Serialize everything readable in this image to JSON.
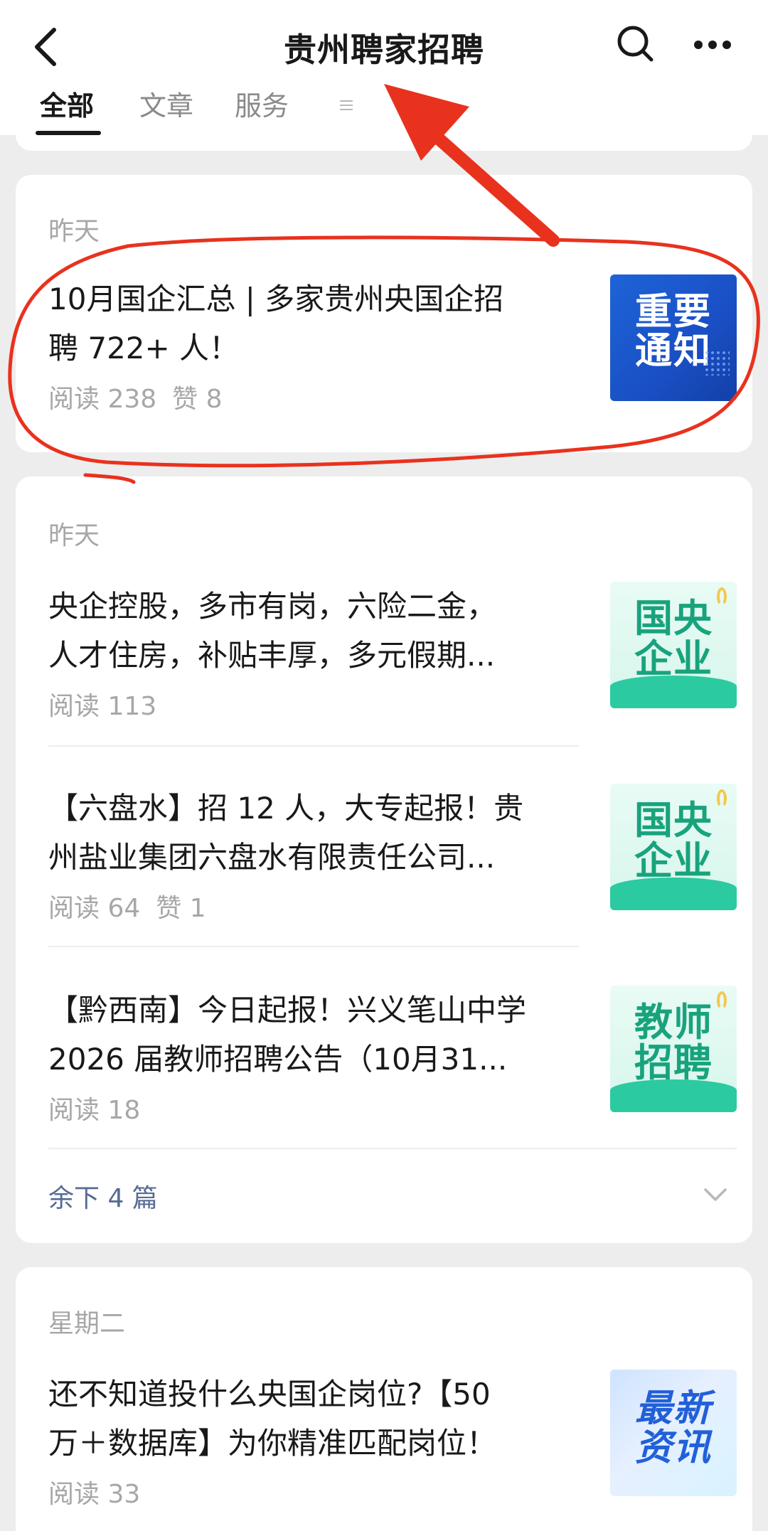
{
  "header": {
    "title": "贵州聘家招聘",
    "tabs": [
      "全部",
      "文章",
      "服务"
    ]
  },
  "cards": [
    {
      "date": "昨天",
      "items": [
        {
          "title_lines": [
            "10月国企汇总 | 多家贵州央国企招",
            "聘 722+ 人！"
          ],
          "reads": "阅读 238",
          "likes": "赞 8",
          "thumb_text": [
            "重要",
            "通知"
          ]
        }
      ]
    },
    {
      "date": "昨天",
      "items": [
        {
          "title_lines": [
            "央企控股，多市有岗，六险二金，",
            "人才住房，补贴丰厚，多元假期..."
          ],
          "reads": "阅读 113",
          "thumb_text": [
            "国央",
            "企业"
          ]
        },
        {
          "title_lines": [
            "【六盘水】招 12 人，大专起报！贵",
            "州盐业集团六盘水有限责任公司..."
          ],
          "reads": "阅读 64",
          "likes": "赞 1",
          "thumb_text": [
            "国央",
            "企业"
          ]
        },
        {
          "title_lines": [
            "【黔西南】今日起报！兴义笔山中学",
            "2026 届教师招聘公告（10月31..."
          ],
          "reads": "阅读 18",
          "thumb_text": [
            "教师",
            "招聘"
          ]
        }
      ],
      "more_label": "余下 4 篇"
    },
    {
      "date": "星期二",
      "items": [
        {
          "title_lines": [
            "还不知道投什么央国企岗位?【50",
            "万＋数据库】为你精准匹配岗位！"
          ],
          "reads": "阅读 33",
          "thumb_text": [
            "最新",
            "资讯"
          ]
        }
      ]
    }
  ],
  "colors": {
    "annotation_red": "#e8321e",
    "link_blue": "#576b95"
  }
}
